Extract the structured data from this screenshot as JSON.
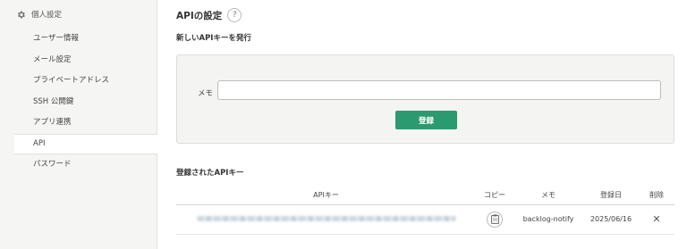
{
  "sidebar": {
    "header": "個人設定",
    "items": [
      {
        "label": "ユーザー情報"
      },
      {
        "label": "メール設定"
      },
      {
        "label": "プライベートアドレス"
      },
      {
        "label": "SSH 公開鍵"
      },
      {
        "label": "アプリ連携"
      },
      {
        "label": "API"
      },
      {
        "label": "パスワード"
      }
    ]
  },
  "main": {
    "title": "APIの設定",
    "help_glyph": "?",
    "new_key_title": "新しいAPIキーを発行",
    "memo_label": "メモ",
    "memo_value": "",
    "submit_label": "登録",
    "registered_title": "登録されたAPIキー",
    "table": {
      "headers": [
        "APIキー",
        "コピー",
        "メモ",
        "登録日",
        "削除"
      ],
      "rows": [
        {
          "memo": "backlog-notify",
          "date": "2025/06/16",
          "delete": "✕"
        }
      ]
    }
  },
  "colors": {
    "accent": "#2b9a70",
    "sidebar_bg": "#f5f5f4",
    "form_bg": "#f4f4f3"
  }
}
